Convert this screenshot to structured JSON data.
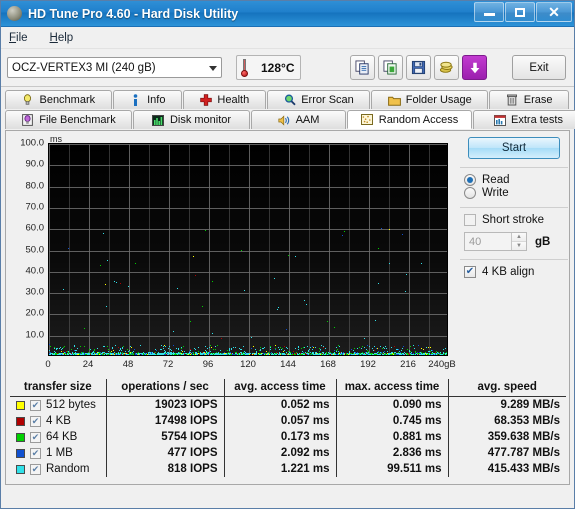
{
  "window": {
    "title": "HD Tune Pro 4.60 - Hard Disk Utility",
    "icon": "disk-platter-icon",
    "controls": {
      "minimize": "–",
      "maximize": "□",
      "close": "✕"
    }
  },
  "menu": {
    "items": [
      "File",
      "Help"
    ]
  },
  "toolbar": {
    "drive_selected": "OCZ-VERTEX3 MI (240 gB)",
    "temperature": "128°C",
    "temp_icon": "thermometer-icon",
    "buttons": [
      {
        "name": "copy-icon",
        "label": ""
      },
      {
        "name": "copy-sheet-icon",
        "label": ""
      },
      {
        "name": "save-floppy-icon",
        "label": ""
      },
      {
        "name": "coins-icon",
        "label": ""
      },
      {
        "name": "download-arrow-icon",
        "label": ""
      }
    ],
    "exit_label": "Exit"
  },
  "tabs": {
    "row1": [
      {
        "label": "Benchmark",
        "icon": "lightbulb-icon",
        "active": false
      },
      {
        "label": "Info",
        "icon": "info-icon",
        "active": false
      },
      {
        "label": "Health",
        "icon": "red-cross-icon",
        "active": false
      },
      {
        "label": "Error Scan",
        "icon": "magnifier-icon",
        "active": false
      },
      {
        "label": "Folder Usage",
        "icon": "folder-icon",
        "active": false
      },
      {
        "label": "Erase",
        "icon": "trash-icon",
        "active": false
      }
    ],
    "row2": [
      {
        "label": "File Benchmark",
        "icon": "file-benchmark-icon",
        "active": false
      },
      {
        "label": "Disk monitor",
        "icon": "bar-chart-icon",
        "active": false
      },
      {
        "label": "AAM",
        "icon": "speaker-icon",
        "active": false
      },
      {
        "label": "Random Access",
        "icon": "scatter-dots-icon",
        "active": true
      },
      {
        "label": "Extra tests",
        "icon": "grid-chart-icon",
        "active": false
      }
    ]
  },
  "controls": {
    "start_label": "Start",
    "mode": {
      "read_label": "Read",
      "write_label": "Write",
      "selected": "Read"
    },
    "short_stroke": {
      "label": "Short stroke",
      "checked": false
    },
    "short_stroke_value": "40",
    "short_stroke_unit": "gB",
    "align": {
      "label": "4 KB align",
      "checked": true
    }
  },
  "chart_data": {
    "type": "scatter",
    "title": "",
    "xlabel": "gB",
    "ylabel": "ms",
    "y_unit": "ms",
    "x_unit_suffix": "gB",
    "xlim": [
      0,
      240
    ],
    "ylim": [
      0,
      100
    ],
    "yticks": [
      "100.0",
      "90.0",
      "80.0",
      "70.0",
      "60.0",
      "50.0",
      "40.0",
      "30.0",
      "20.0",
      "10.0"
    ],
    "ytick_values": [
      100,
      90,
      80,
      70,
      60,
      50,
      40,
      30,
      20,
      10
    ],
    "xticks": [
      "0",
      "24",
      "48",
      "72",
      "96",
      "120",
      "144",
      "168",
      "192",
      "216",
      "240gB"
    ],
    "xtick_values": [
      0,
      24,
      48,
      72,
      96,
      120,
      144,
      168,
      192,
      216,
      240
    ],
    "grid": true,
    "background": "#000000",
    "grid_color": "#6f6f6f",
    "series": [
      {
        "name": "512 bytes",
        "color": "#ffff00",
        "avg_ms": 0.052,
        "max_ms": 0.09
      },
      {
        "name": "4 KB",
        "color": "#b00000",
        "avg_ms": 0.057,
        "max_ms": 0.745
      },
      {
        "name": "64 KB",
        "color": "#00d000",
        "avg_ms": 0.173,
        "max_ms": 0.881
      },
      {
        "name": "1 MB",
        "color": "#1050d0",
        "avg_ms": 2.092,
        "max_ms": 2.836
      },
      {
        "name": "Random",
        "color": "#30e0e8",
        "avg_ms": 1.221,
        "max_ms": 99.511
      }
    ],
    "note": "Dense point cloud concentrated below ~5 ms across the full 0-240 gB span; a few outliers scattered higher."
  },
  "results": {
    "columns": [
      "transfer size",
      "operations / sec",
      "avg. access time",
      "max. access time",
      "avg. speed"
    ],
    "rows": [
      {
        "color": "#ffff00",
        "checked": true,
        "size": "512 bytes",
        "iops": "19023 IOPS",
        "avg": "0.052 ms",
        "max": "0.090 ms",
        "speed": "9.289 MB/s"
      },
      {
        "color": "#b00000",
        "checked": true,
        "size": "4 KB",
        "iops": "17498 IOPS",
        "avg": "0.057 ms",
        "max": "0.745 ms",
        "speed": "68.353 MB/s"
      },
      {
        "color": "#00d000",
        "checked": true,
        "size": "64 KB",
        "iops": "5754 IOPS",
        "avg": "0.173 ms",
        "max": "0.881 ms",
        "speed": "359.638 MB/s"
      },
      {
        "color": "#1050d0",
        "checked": true,
        "size": "1 MB",
        "iops": "477 IOPS",
        "avg": "2.092 ms",
        "max": "2.836 ms",
        "speed": "477.787 MB/s"
      },
      {
        "color": "#30e0e8",
        "checked": true,
        "size": "Random",
        "iops": "818 IOPS",
        "avg": "1.221 ms",
        "max": "99.511 ms",
        "speed": "415.433 MB/s"
      }
    ]
  }
}
